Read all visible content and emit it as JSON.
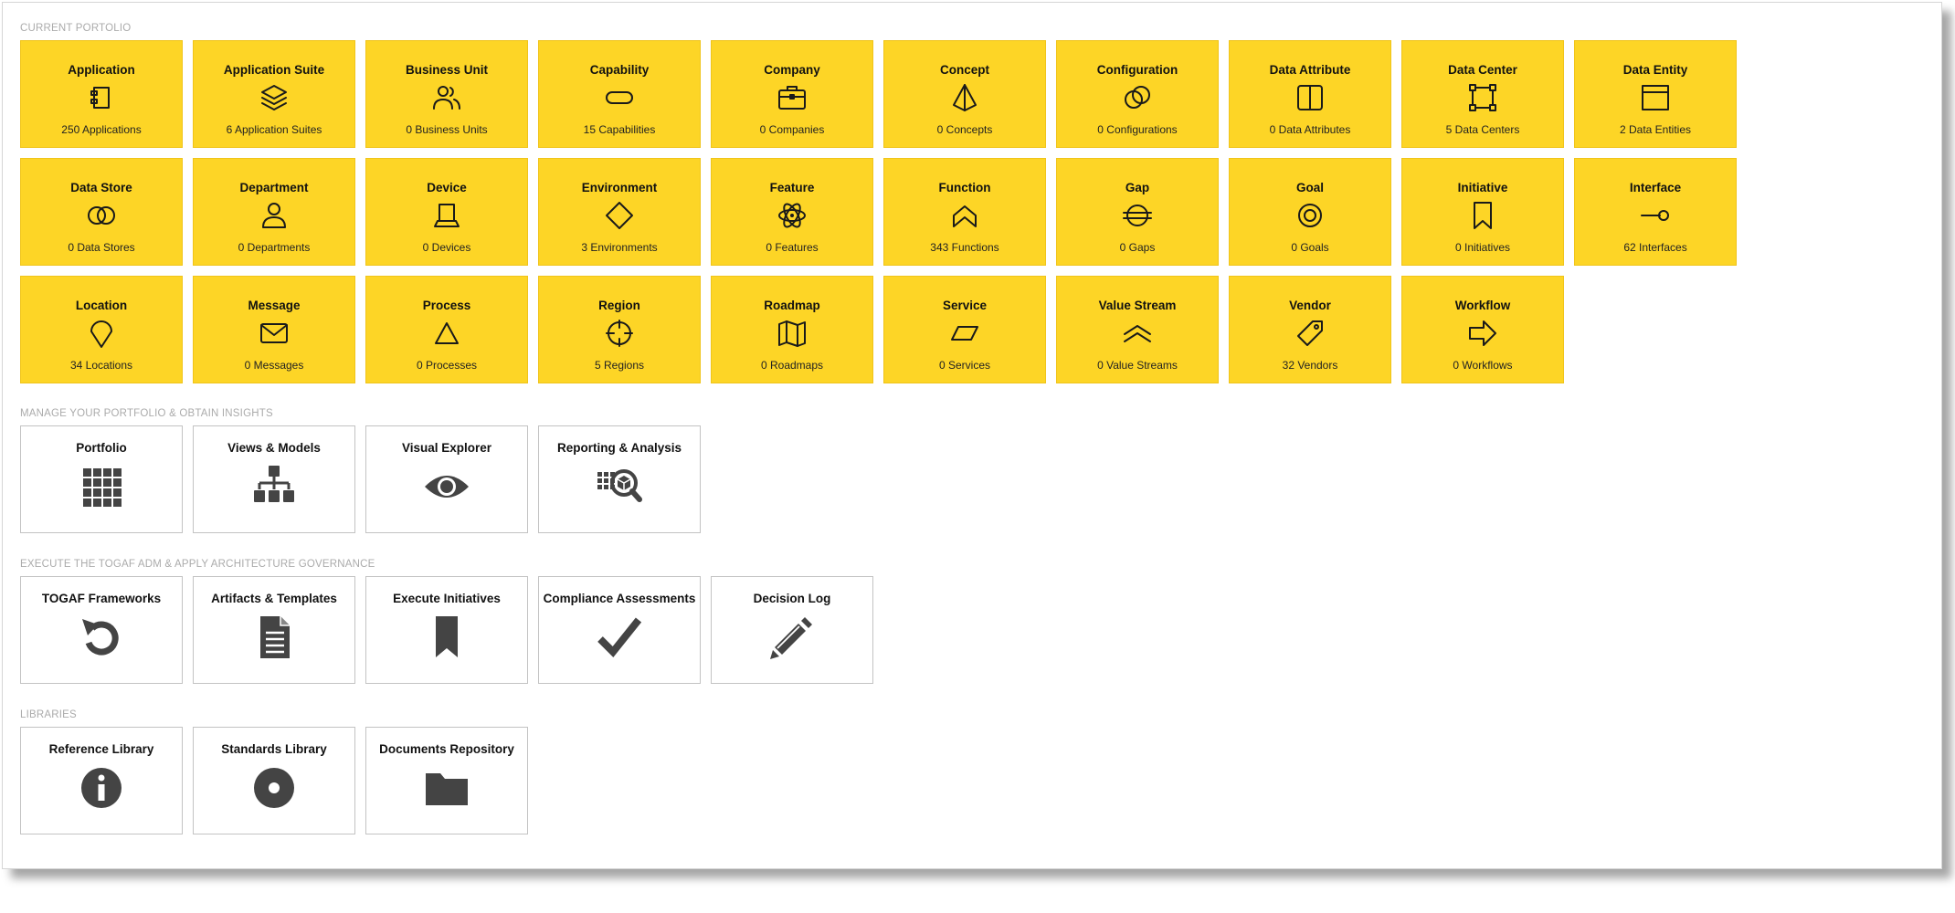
{
  "sections": {
    "portfolio": "CURRENT PORTOLIO",
    "manage": "MANAGE YOUR PORTFOLIO & OBTAIN INSIGHTS",
    "execute": "EXECUTE THE TOGAF ADM & APPLY ARCHITECTURE GOVERNANCE",
    "libraries": "LIBRARIES"
  },
  "portfolio": [
    {
      "title": "Application",
      "count": "250 Applications",
      "icon": "application-icon"
    },
    {
      "title": "Application Suite",
      "count": "6 Application Suites",
      "icon": "layers-icon"
    },
    {
      "title": "Business Unit",
      "count": "0 Business Units",
      "icon": "users-icon"
    },
    {
      "title": "Capability",
      "count": "15 Capabilities",
      "icon": "pill-icon"
    },
    {
      "title": "Company",
      "count": "0 Companies",
      "icon": "briefcase-icon"
    },
    {
      "title": "Concept",
      "count": "0 Concepts",
      "icon": "prism-icon"
    },
    {
      "title": "Configuration",
      "count": "0 Configurations",
      "icon": "overlap-circles-icon"
    },
    {
      "title": "Data Attribute",
      "count": "0 Data Attributes",
      "icon": "split-panel-icon"
    },
    {
      "title": "Data Center",
      "count": "5 Data Centers",
      "icon": "bounding-box-icon"
    },
    {
      "title": "Data Entity",
      "count": "2 Data Entities",
      "icon": "window-icon"
    },
    {
      "title": "Data Store",
      "count": "0 Data Stores",
      "icon": "linked-circles-icon"
    },
    {
      "title": "Department",
      "count": "0 Departments",
      "icon": "person-icon"
    },
    {
      "title": "Device",
      "count": "0 Devices",
      "icon": "laptop-icon"
    },
    {
      "title": "Environment",
      "count": "3 Environments",
      "icon": "diamond-icon"
    },
    {
      "title": "Feature",
      "count": "0 Features",
      "icon": "atom-icon"
    },
    {
      "title": "Function",
      "count": "343 Functions",
      "icon": "chevron-up-icon"
    },
    {
      "title": "Gap",
      "count": "0 Gaps",
      "icon": "circle-lines-icon"
    },
    {
      "title": "Goal",
      "count": "0 Goals",
      "icon": "target-icon"
    },
    {
      "title": "Initiative",
      "count": "0 Initiatives",
      "icon": "bookmark-icon"
    },
    {
      "title": "Interface",
      "count": "62 Interfaces",
      "icon": "lollipop-icon"
    },
    {
      "title": "Location",
      "count": "34 Locations",
      "icon": "map-pin-icon"
    },
    {
      "title": "Message",
      "count": "0 Messages",
      "icon": "envelope-icon"
    },
    {
      "title": "Process",
      "count": "0 Processes",
      "icon": "triangle-icon"
    },
    {
      "title": "Region",
      "count": "5 Regions",
      "icon": "crosshair-icon"
    },
    {
      "title": "Roadmap",
      "count": "0 Roadmaps",
      "icon": "map-icon"
    },
    {
      "title": "Service",
      "count": "0 Services",
      "icon": "parallelogram-icon"
    },
    {
      "title": "Value Stream",
      "count": "0 Value Streams",
      "icon": "double-chevron-up-icon"
    },
    {
      "title": "Vendor",
      "count": "32 Vendors",
      "icon": "tag-icon"
    },
    {
      "title": "Workflow",
      "count": "0 Workflows",
      "icon": "arrow-right-icon"
    }
  ],
  "manage": [
    {
      "title": "Portfolio",
      "icon": "grid-icon"
    },
    {
      "title": "Views & Models",
      "icon": "hierarchy-icon"
    },
    {
      "title": "Visual Explorer",
      "icon": "eye-icon"
    },
    {
      "title": "Reporting & Analysis",
      "icon": "analysis-search-icon"
    }
  ],
  "execute": [
    {
      "title": "TOGAF Frameworks",
      "icon": "cycle-arrow-icon"
    },
    {
      "title": "Artifacts & Templates",
      "icon": "document-icon"
    },
    {
      "title": "Execute Initiatives",
      "icon": "bookmark-solid-icon"
    },
    {
      "title": "Compliance Assessments",
      "icon": "checkmark-icon"
    },
    {
      "title": "Decision Log",
      "icon": "pencil-icon"
    }
  ],
  "libraries": [
    {
      "title": "Reference Library",
      "icon": "info-icon"
    },
    {
      "title": "Standards Library",
      "icon": "disc-icon"
    },
    {
      "title": "Documents Repository",
      "icon": "folder-icon"
    }
  ],
  "colors": {
    "tile_yellow": "#fdd526",
    "icon_dark": "#444444",
    "section_label": "#ababab"
  }
}
